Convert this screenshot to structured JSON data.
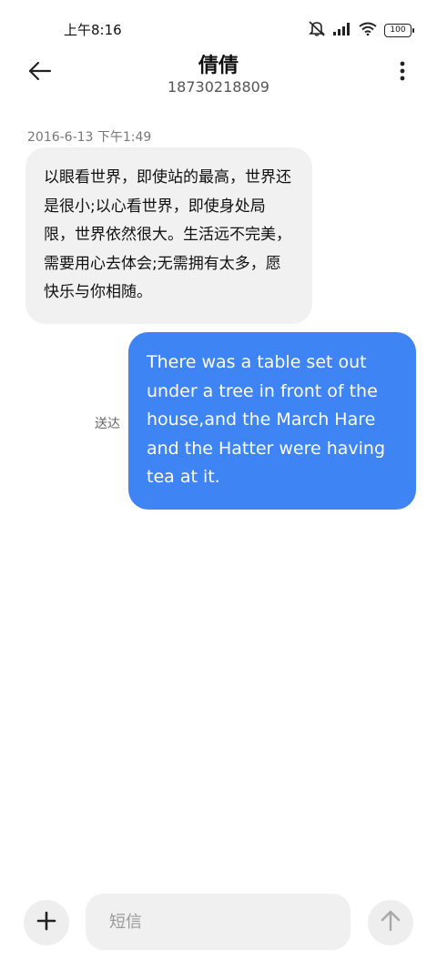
{
  "status_bar": {
    "time": "上午8:16",
    "battery": "100",
    "icons": [
      "mute-icon",
      "signal-icon",
      "wifi-icon",
      "battery-icon"
    ]
  },
  "header": {
    "contact_name": "倩倩",
    "contact_number": "18730218809",
    "icons": [
      "back-arrow-icon",
      "more-vertical-icon"
    ]
  },
  "conversation": {
    "timestamp": "2016-6-13 下午1:49",
    "messages": [
      {
        "direction": "incoming",
        "text": "以眼看世界，即使站的最高，世界还是很小;以心看世界，即使身处局限，世界依然很大。生活远不完美，需要用心去体会;无需拥有太多，愿快乐与你相随。"
      },
      {
        "direction": "outgoing",
        "text": "There was a table set out under a tree in front of the house,and the March Hare and the Hatter were having tea at it.",
        "status": "送达"
      }
    ]
  },
  "composer": {
    "placeholder": "短信",
    "value": "",
    "icons": [
      "plus-icon",
      "send-arrow-icon"
    ]
  },
  "colors": {
    "outgoing_bubble": "#3f84f4",
    "incoming_bubble": "#f1f1f1",
    "background": "#ffffff"
  }
}
